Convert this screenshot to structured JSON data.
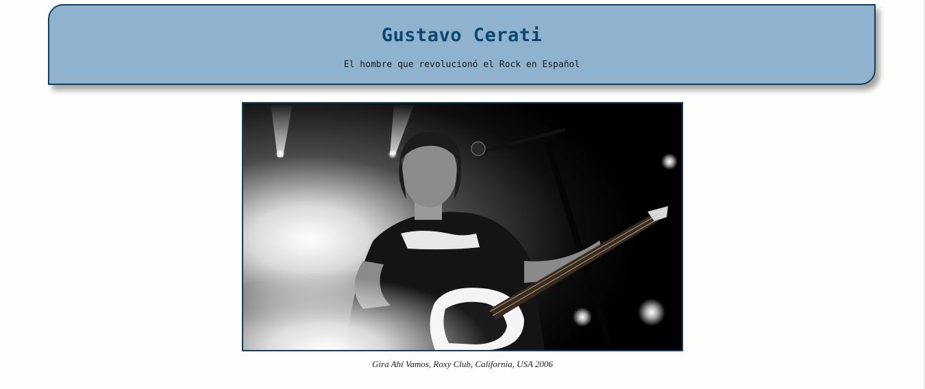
{
  "header": {
    "title": "Gustavo Cerati",
    "subtitle": "El hombre que revolucionó el Rock en Español"
  },
  "figure": {
    "caption": "Gira Ahí Vamos, Roxy Club, California, USA 2006",
    "image_subject": "black-and-white concert photo of guitarist singing at a microphone"
  },
  "colors": {
    "header_bg": "#8fb3cf",
    "header_border": "#0e3f63",
    "title": "#0e4670"
  }
}
